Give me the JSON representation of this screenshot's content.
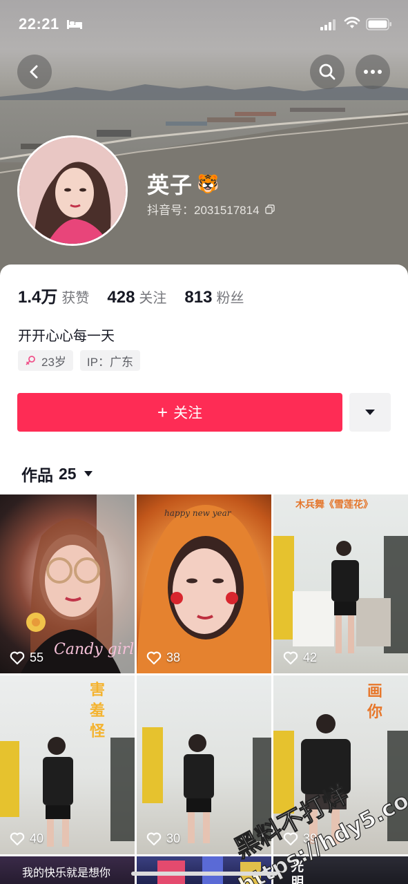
{
  "status_bar": {
    "time": "22:21"
  },
  "profile": {
    "nickname": "英子",
    "nickname_emoji": "🐯",
    "douyin_id": "抖音号：2031517814"
  },
  "stats": [
    {
      "value": "1.4万",
      "label": "获赞"
    },
    {
      "value": "428",
      "label": "关注"
    },
    {
      "value": "813",
      "label": "粉丝"
    }
  ],
  "bio": "开开心心每一天",
  "tags": {
    "age": "23岁",
    "ip": "IP：广东"
  },
  "follow_button": {
    "label": "关注"
  },
  "works_tab": {
    "label": "作品",
    "count": "25"
  },
  "videos": [
    {
      "likes": "55",
      "overlay": "Candy girl"
    },
    {
      "likes": "38",
      "overlay": "happy new year"
    },
    {
      "likes": "42",
      "overlay": "木兵舞《雪莲花》"
    },
    {
      "likes": "40",
      "overlay": "害羞怪"
    },
    {
      "likes": "30",
      "overlay": ""
    },
    {
      "likes": "39",
      "overlay": "画你"
    },
    {
      "likes": "",
      "overlay": "我的快乐就是想你"
    },
    {
      "likes": "",
      "overlay": ""
    },
    {
      "likes": "",
      "overlay": "光明"
    }
  ],
  "watermark": {
    "line1": "黑料不打烊",
    "line2": "https://hdy5.co"
  },
  "colors": {
    "accent": "#fe2c55",
    "text": "#161823",
    "secondary": "#76777c"
  }
}
